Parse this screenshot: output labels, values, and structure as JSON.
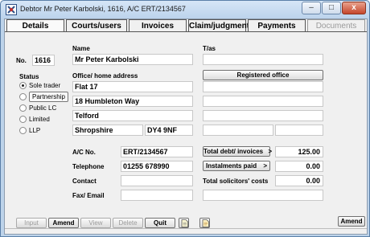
{
  "window": {
    "title": "Debtor Mr Peter Karbolski, 1616, A/C ERT/2134567",
    "minimize": "–",
    "maximize": "□",
    "close": "x"
  },
  "tabs": [
    "Details",
    "Courts/users",
    "Invoices",
    "Claim/judgment",
    "Payments",
    "Documents"
  ],
  "left": {
    "no_label": "No.",
    "no_value": "1616",
    "status_label": "Status",
    "status_options": [
      "Sole trader",
      "Partnership",
      "Public LC",
      "Limited",
      "LLP"
    ],
    "status_selected": "Sole trader"
  },
  "form": {
    "name_label": "Name",
    "name_value": "Mr Peter Karbolski",
    "tas_label": "T/as",
    "tas_value": "",
    "office_label": "Office/ home address",
    "address": [
      "Flat 17",
      "18 Humbleton Way",
      "Telford",
      "Shropshire"
    ],
    "postcode": "DY4 9NF",
    "registered_office_button": "Registered office",
    "ac_label": "A/C No.",
    "ac_value": "ERT/2134567",
    "telephone_label": "Telephone",
    "telephone_value": "01255 678990",
    "contact_label": "Contact",
    "contact_value": "",
    "fax_label": "Fax/ Email",
    "fax_value": "",
    "total_debt_button": "Total debt/ invoices",
    "total_debt_value": "125.00",
    "instalments_button": "Instalments paid",
    "instalments_value": "0.00",
    "solicitors_label": "Total solicitors' costs",
    "solicitors_value": "0.00",
    "arrow": ">"
  },
  "bottom": {
    "input": "Input",
    "amend": "Amend",
    "view": "View",
    "delete": "Delete",
    "quit": "Quit",
    "amend_right": "Amend"
  }
}
